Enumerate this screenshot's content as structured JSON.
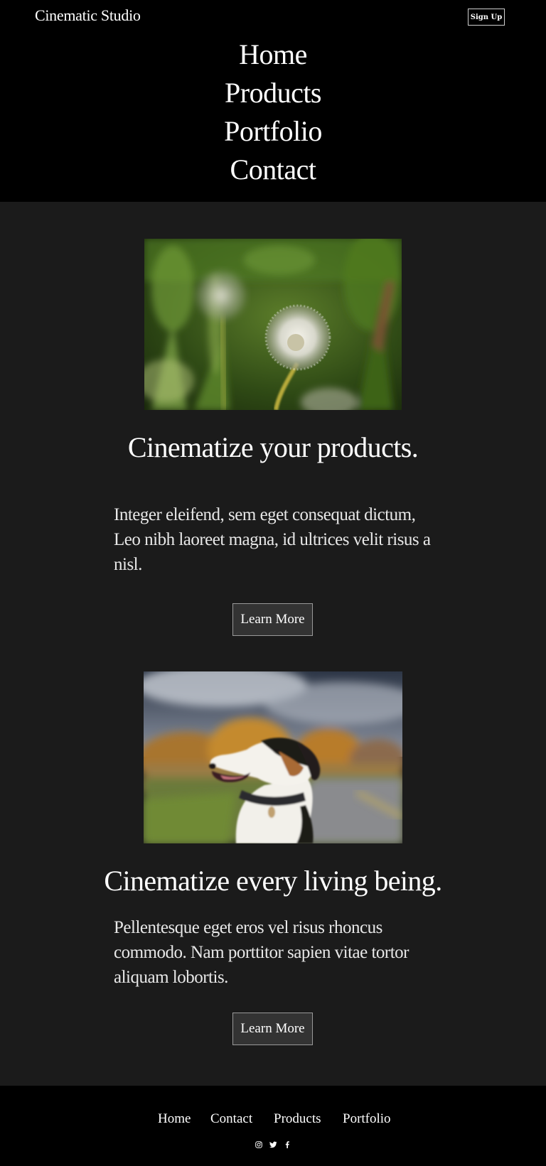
{
  "header": {
    "brand": "Cinematic Studio",
    "signup_label": "Sign Up",
    "nav": [
      "Home",
      "Products",
      "Portfolio",
      "Contact"
    ]
  },
  "sections": [
    {
      "image": "dandelion-photo",
      "headline": "Cinematize your products.",
      "body": "Integer eleifend, sem eget consequat dictum, Leo nibh laoreet magna, id ultrices velit risus a nisl.",
      "button_label": "Learn More"
    },
    {
      "image": "dog-photo",
      "headline": "Cinematize every living being.",
      "body": "Pellentesque eget eros vel risus rhoncus commodo. Nam porttitor sapien vitae tortor aliquam lobortis.",
      "button_label": "Learn More"
    }
  ],
  "footer": {
    "nav": [
      "Home",
      "Contact",
      "Products",
      "Portfolio"
    ],
    "social_icons": [
      "instagram-icon",
      "twitter-icon",
      "facebook-icon"
    ]
  },
  "colors": {
    "header_bg": "#000000",
    "page_bg": "#1b1b1b",
    "button_bg": "#333333",
    "text": "#ffffff"
  }
}
